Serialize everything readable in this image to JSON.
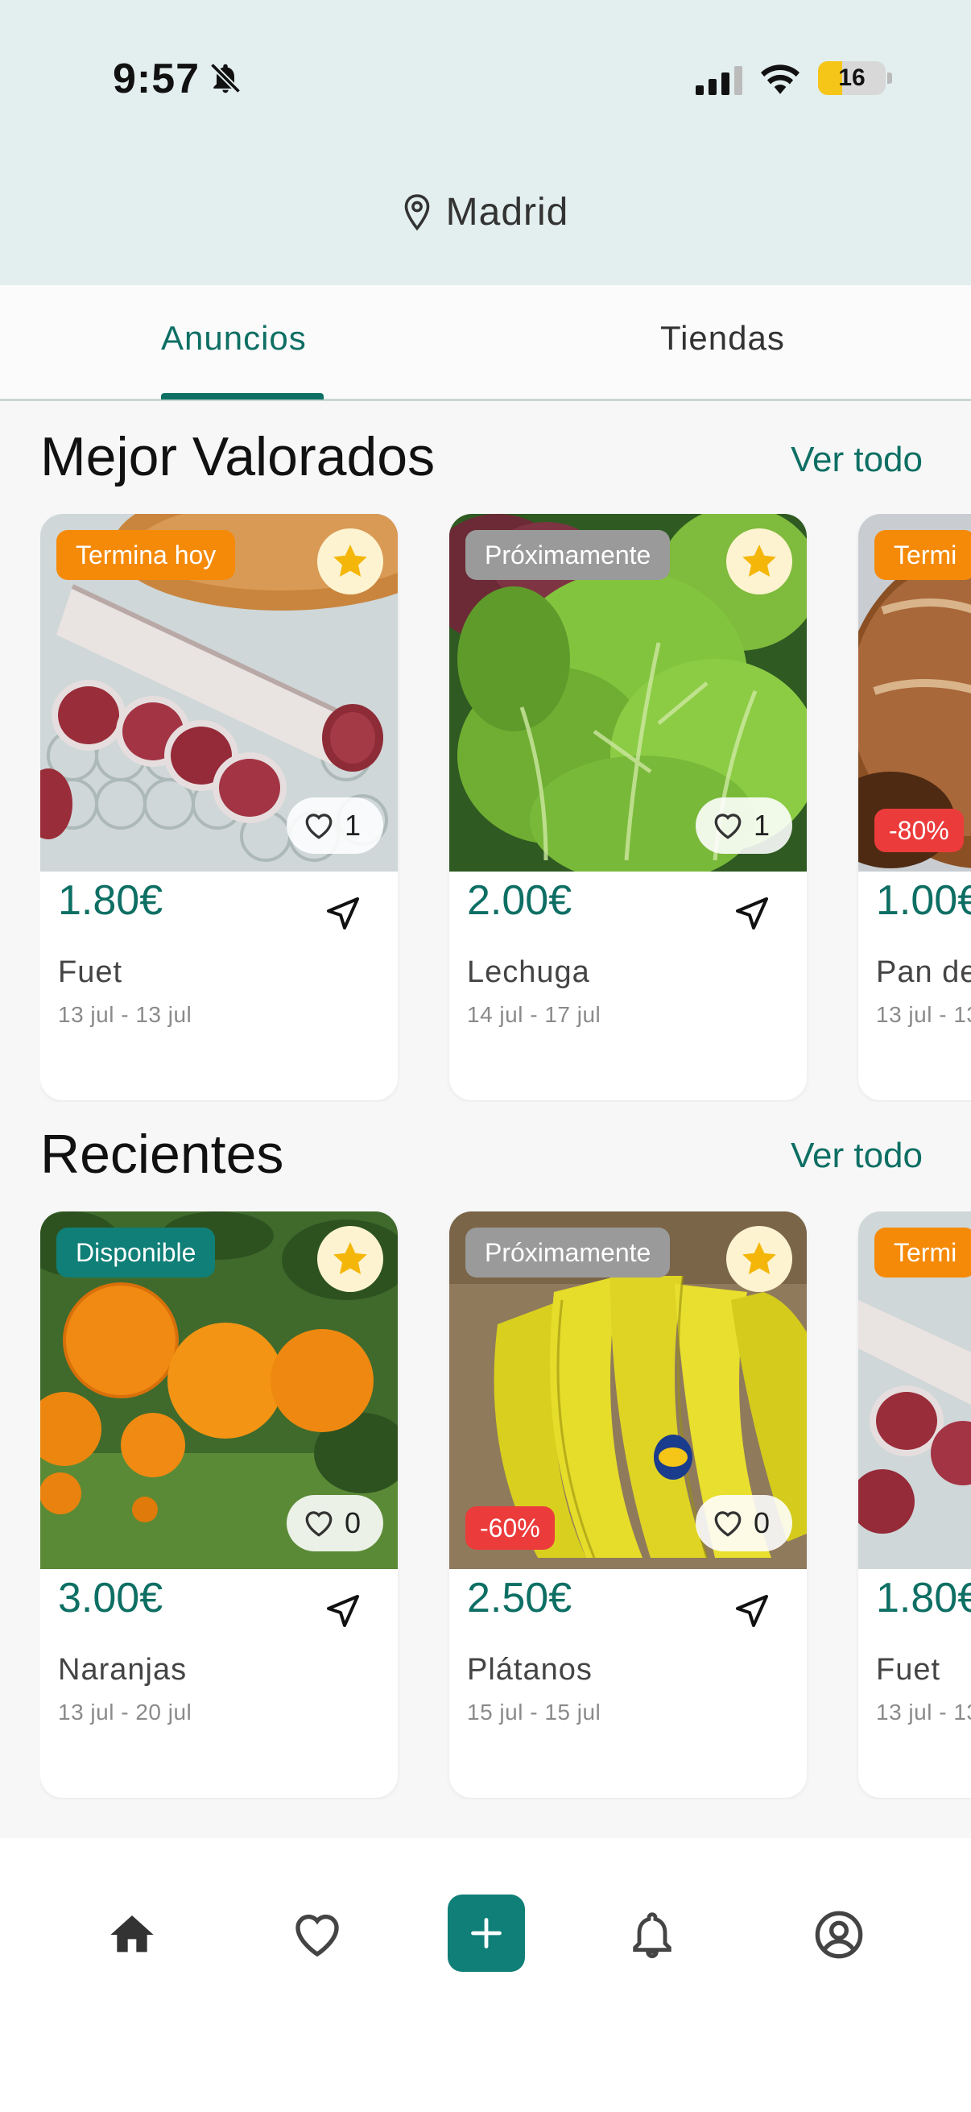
{
  "status_bar": {
    "time": "9:57",
    "battery": "16"
  },
  "header": {
    "location": "Madrid"
  },
  "tabs": [
    {
      "label": "Anuncios",
      "active": true
    },
    {
      "label": "Tiendas",
      "active": false
    }
  ],
  "sections": [
    {
      "title": "Mejor Valorados",
      "see_all": "Ver todo",
      "cards": [
        {
          "badge": "Termina hoy",
          "badge_color": "#f58a09",
          "likes": "1",
          "price": "1.80€",
          "name": "Fuet",
          "dates": "13 jul - 13 jul",
          "discount": ""
        },
        {
          "badge": "Próximamente",
          "badge_color": "#9a9a9a",
          "likes": "1",
          "price": "2.00€",
          "name": "Lechuga",
          "dates": "14 jul - 17 jul",
          "discount": ""
        },
        {
          "badge": "Termi",
          "badge_color": "#f58a09",
          "likes": "",
          "price": "1.00€",
          "name": "Pan de",
          "dates": "13 jul - 13",
          "discount": "-80%"
        }
      ]
    },
    {
      "title": "Recientes",
      "see_all": "Ver todo",
      "cards": [
        {
          "badge": "Disponible",
          "badge_color": "#0f7f77",
          "likes": "0",
          "price": "3.00€",
          "name": "Naranjas",
          "dates": "13 jul - 20 jul",
          "discount": ""
        },
        {
          "badge": "Próximamente",
          "badge_color": "#9a9a9a",
          "likes": "0",
          "price": "2.50€",
          "name": "Plátanos",
          "dates": "15 jul - 15 jul",
          "discount": "-60%"
        },
        {
          "badge": "Termi",
          "badge_color": "#f58a09",
          "likes": "",
          "price": "1.80€",
          "name": "Fuet",
          "dates": "13 jul - 13",
          "discount": ""
        }
      ]
    }
  ],
  "bottom_nav": [
    "home-icon",
    "heart-icon",
    "plus-icon",
    "bell-icon",
    "profile-icon"
  ],
  "colors": {
    "accent": "#0e6f64",
    "header_bg": "#e3efee",
    "discount": "#ec3b3b",
    "star": "#f5b60a"
  }
}
